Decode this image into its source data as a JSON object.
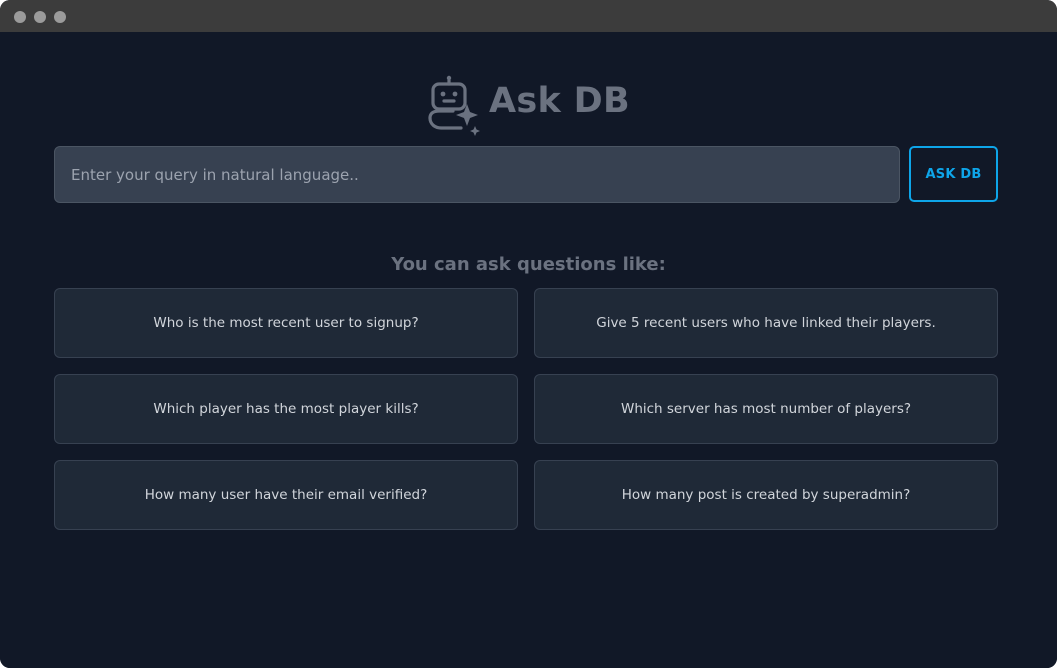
{
  "window": {
    "controls": [
      "close-dot",
      "minimize-dot",
      "zoom-dot"
    ]
  },
  "brand": {
    "title": "Ask DB",
    "icon": "robot-sparkle-icon"
  },
  "search": {
    "placeholder": "Enter your query in natural language..",
    "value": ""
  },
  "ask_button": {
    "label": "ASK DB"
  },
  "suggestions": {
    "heading": "You can ask questions like:",
    "items": [
      "Who is the most recent user to signup?",
      "Give 5 recent users who have linked their players.",
      "Which player has the most player kills?",
      "Which server has most number of players?",
      "How many user have their email verified?",
      "How many post is created by superadmin?"
    ]
  },
  "colors": {
    "background": "#111827",
    "titlebar": "#3c3c3c",
    "input_bg": "#374151",
    "card_bg": "#1f2937",
    "accent": "#0ea5e9",
    "muted_text": "#6b7280"
  }
}
